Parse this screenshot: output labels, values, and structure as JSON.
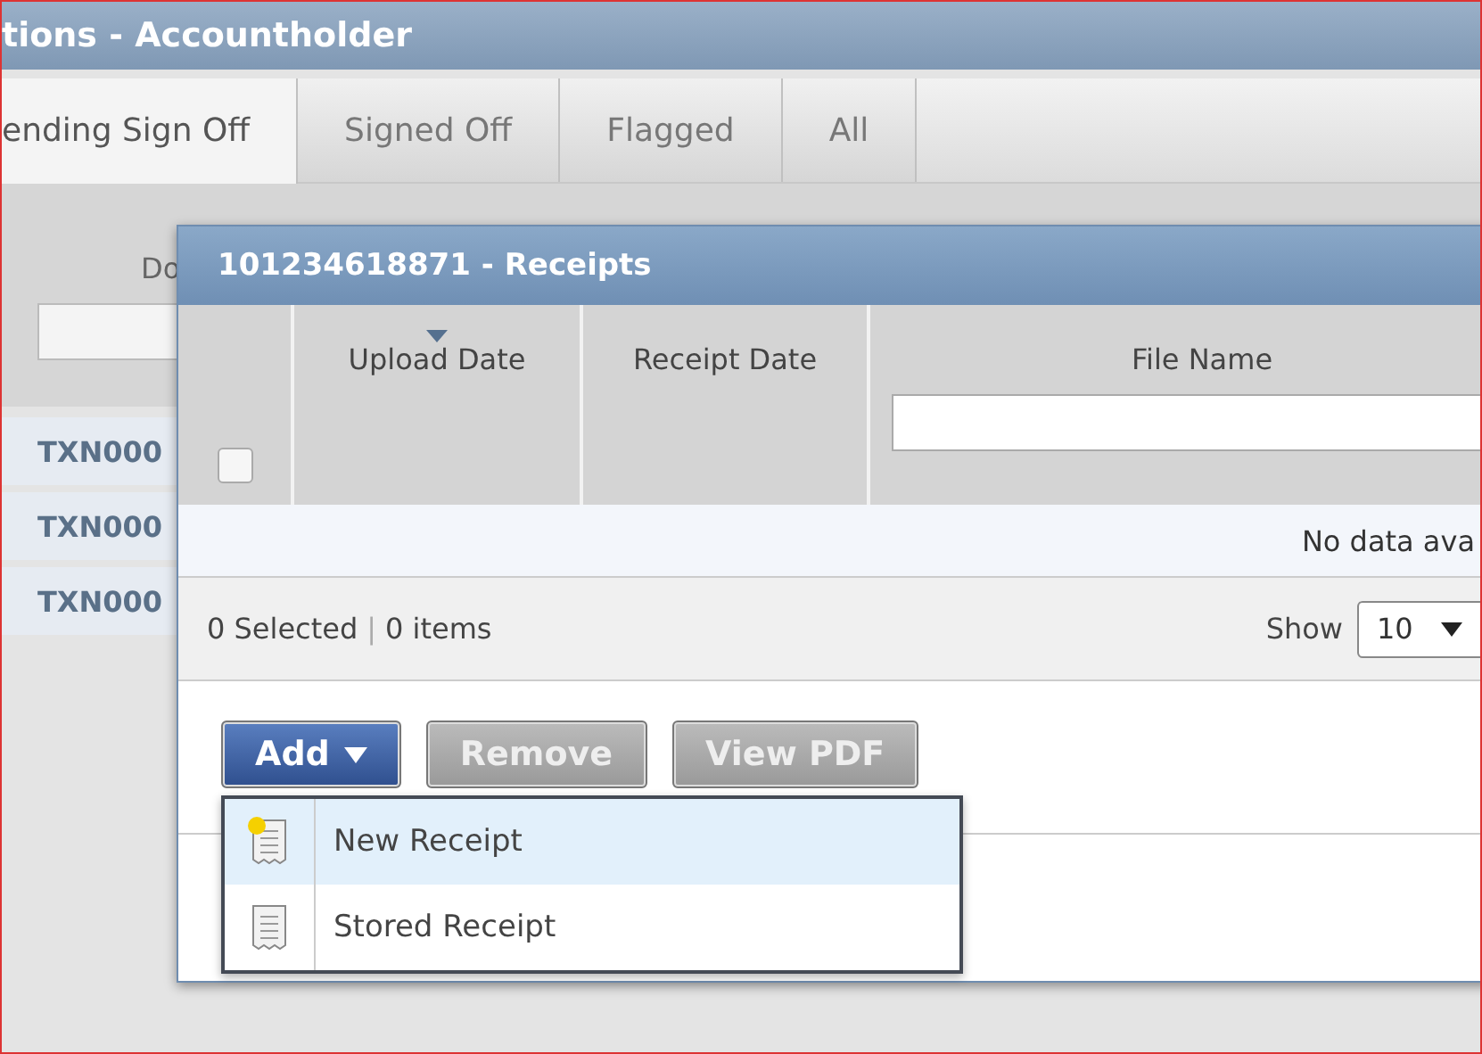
{
  "window": {
    "title": "tions - Accountholder"
  },
  "tabs": [
    {
      "label": "ending Sign Off",
      "selected": true
    },
    {
      "label": "Signed Off",
      "selected": false
    },
    {
      "label": "Flagged",
      "selected": false
    },
    {
      "label": "All",
      "selected": false
    }
  ],
  "grid": {
    "column_1": "Do",
    "rows": [
      "TXN000",
      "TXN000",
      "TXN000"
    ]
  },
  "dialog": {
    "title": "101234618871 - Receipts",
    "select_all": {
      "checked": false
    },
    "columns": [
      {
        "label": "Upload Date",
        "sorted": true
      },
      {
        "label": "Receipt Date",
        "sorted": false
      },
      {
        "label": "File Name",
        "sorted": false,
        "filter": true
      }
    ],
    "empty_message": "No data ava",
    "footer": {
      "selected": "0 Selected",
      "separator": "|",
      "items": "0 items",
      "show_label": "Show",
      "page_size": "10"
    },
    "buttons": [
      {
        "label": "Add",
        "kind": "menu",
        "disabled": false
      },
      {
        "label": "Remove",
        "kind": "plain",
        "disabled": true
      },
      {
        "label": "View PDF",
        "kind": "plain",
        "disabled": true
      }
    ],
    "menu": [
      {
        "label": "New Receipt",
        "kind": "new",
        "highlighted": true
      },
      {
        "label": "Stored Receipt",
        "kind": "stored",
        "highlighted": false
      }
    ]
  }
}
